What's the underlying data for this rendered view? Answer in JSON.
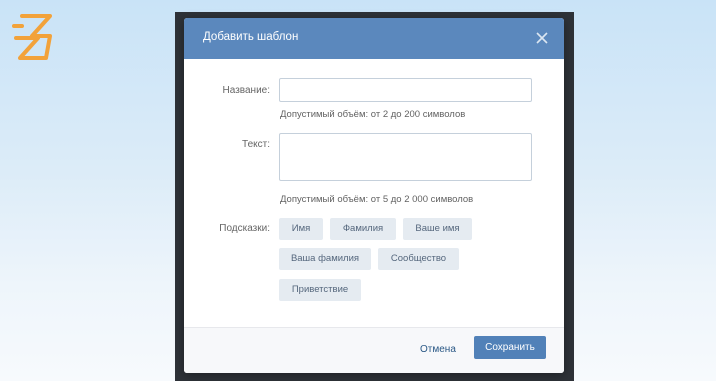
{
  "modal": {
    "title": "Добавить шаблон"
  },
  "form": {
    "name_label": "Название:",
    "name_value": "",
    "name_hint": "Допустимый объём: от 2 до 200 символов",
    "text_label": "Текст:",
    "text_value": "",
    "text_hint": "Допустимый объём: от 5 до 2 000 символов",
    "hints_label": "Подсказки:",
    "hint_chips": [
      "Имя",
      "Фамилия",
      "Ваше имя",
      "Ваша фамилия",
      "Сообщество",
      "Приветствие"
    ]
  },
  "footer": {
    "cancel_label": "Отмена",
    "save_label": "Сохранить"
  },
  "icons": {
    "logo": "z-logo-icon",
    "close": "close-icon"
  },
  "colors": {
    "header": "#5b88bd",
    "primary_button": "#5181b8",
    "chip_bg": "#e5ebf1",
    "logo": "#f2a23a"
  }
}
